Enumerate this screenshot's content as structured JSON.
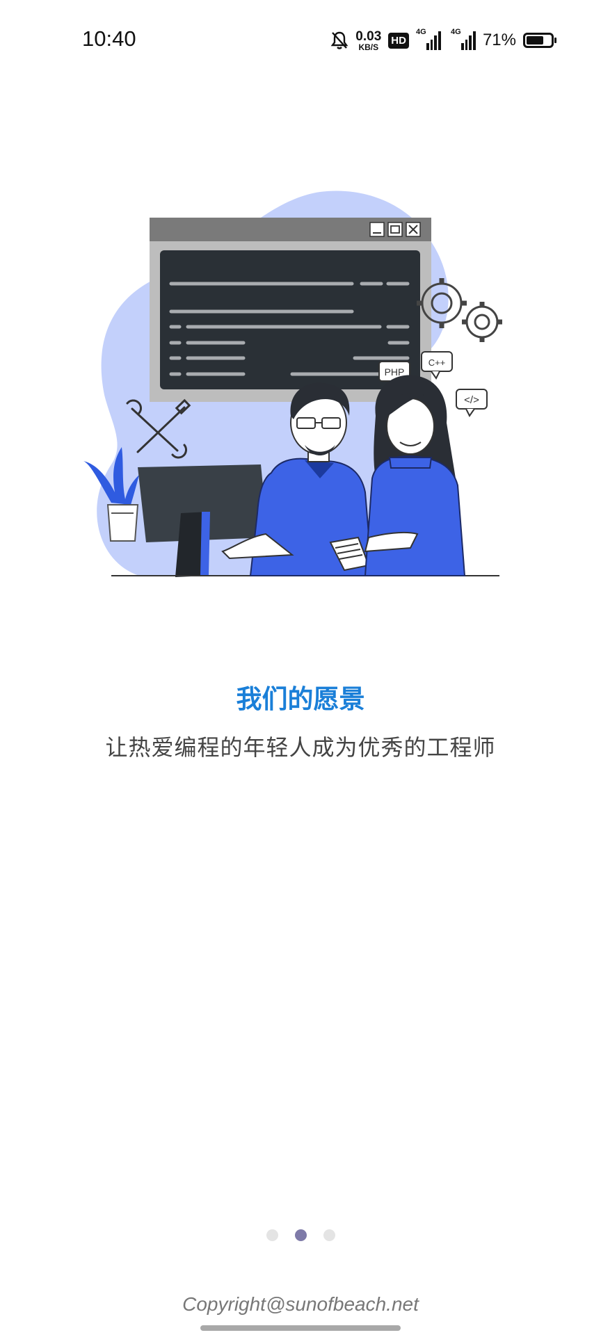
{
  "status_bar": {
    "time": "10:40",
    "net_speed_value": "0.03",
    "net_speed_unit": "KB/S",
    "hd_label": "HD",
    "sim1_label": "4G",
    "sim2_label": "4G",
    "battery_percent": "71%",
    "battery_level": 0.71,
    "icons": [
      "bell-off-icon",
      "signal-icon",
      "battery-icon"
    ]
  },
  "illustration": {
    "window_code_tags": [
      "PHP",
      "C++",
      "</>"
    ]
  },
  "main": {
    "title": "我们的愿景",
    "subtitle": "让热爱编程的年轻人成为优秀的工程师"
  },
  "pager": {
    "total": 3,
    "active_index": 1
  },
  "footer": {
    "copyright": "Copyright@sunofbeach.net"
  },
  "colors": {
    "title": "#1a7fd8",
    "accent_blue": "#3d63e6",
    "bg_blob": "#c3d0fb",
    "dot_active": "#7e7aa8",
    "dot_inactive": "#e4e4e4"
  }
}
